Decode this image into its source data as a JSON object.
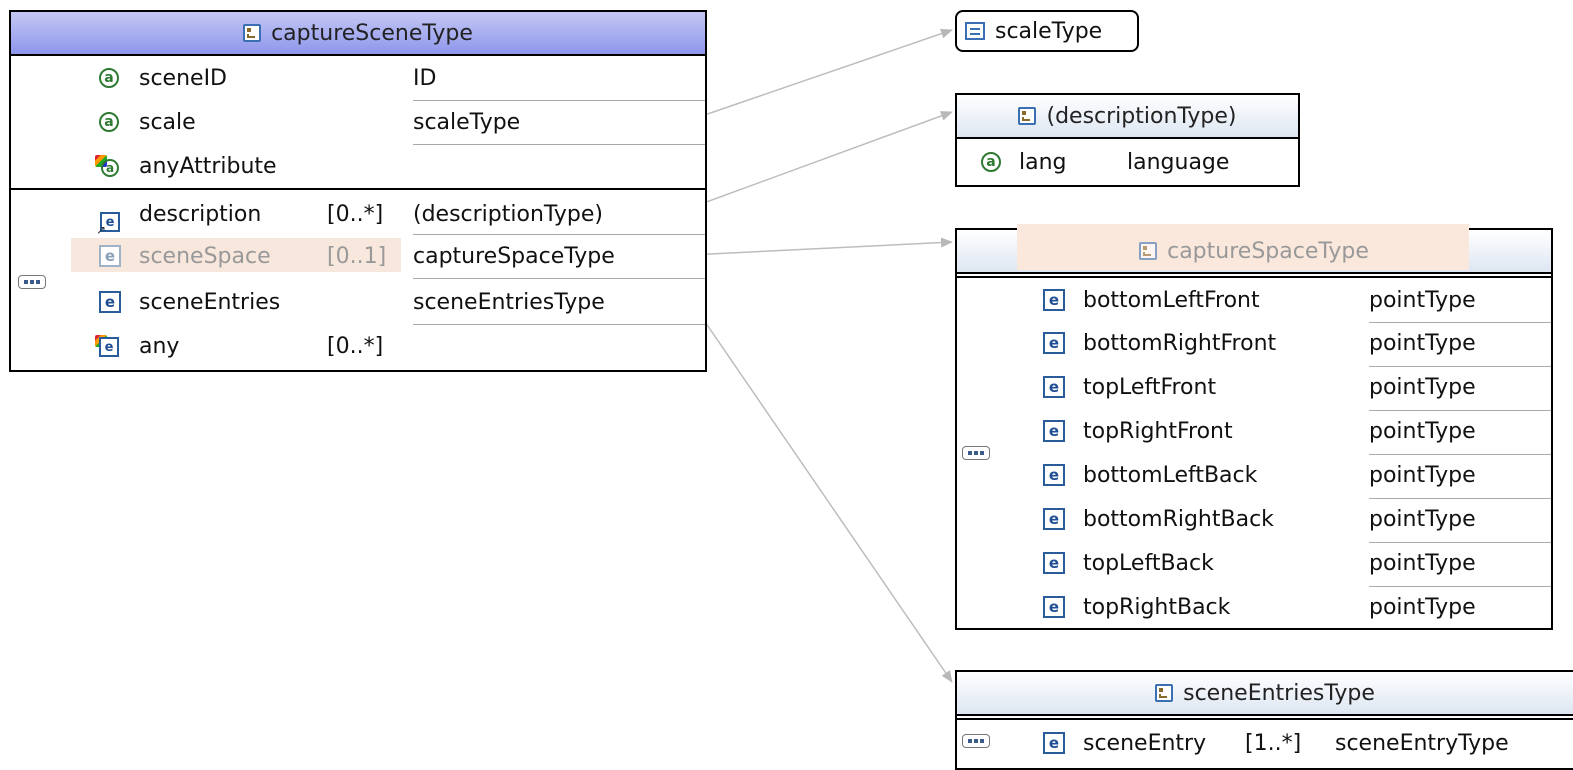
{
  "captureSceneType": {
    "title": "captureSceneType",
    "attributes": [
      {
        "name": "sceneID",
        "type": "ID"
      },
      {
        "name": "scale",
        "type": "scaleType"
      },
      {
        "name": "anyAttribute",
        "type": ""
      }
    ],
    "elements": [
      {
        "name": "description",
        "card": "[0..*]",
        "type": "(descriptionType)"
      },
      {
        "name": "sceneSpace",
        "card": "[0..1]",
        "type": "captureSpaceType"
      },
      {
        "name": "sceneEntries",
        "card": "",
        "type": "sceneEntriesType"
      },
      {
        "name": "any",
        "card": "[0..*]",
        "type": ""
      }
    ]
  },
  "scaleType": {
    "title": "scaleType"
  },
  "descriptionType": {
    "title": "(descriptionType)",
    "attr_name": "lang",
    "attr_type": "language"
  },
  "captureSpaceType": {
    "title": "captureSpaceType",
    "elements": [
      {
        "name": "bottomLeftFront",
        "type": "pointType"
      },
      {
        "name": "bottomRightFront",
        "type": "pointType"
      },
      {
        "name": "topLeftFront",
        "type": "pointType"
      },
      {
        "name": "topRightFront",
        "type": "pointType"
      },
      {
        "name": "bottomLeftBack",
        "type": "pointType"
      },
      {
        "name": "bottomRightBack",
        "type": "pointType"
      },
      {
        "name": "topLeftBack",
        "type": "pointType"
      },
      {
        "name": "topRightBack",
        "type": "pointType"
      }
    ]
  },
  "sceneEntriesType": {
    "title": "sceneEntriesType",
    "element_name": "sceneEntry",
    "element_card": "[1..*]",
    "element_type": "sceneEntryType"
  }
}
